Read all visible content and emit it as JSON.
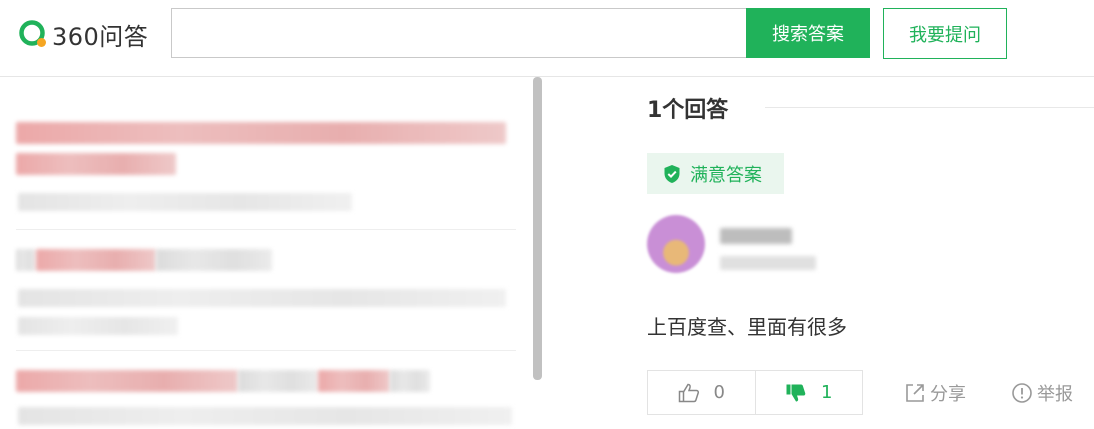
{
  "header": {
    "logo_text": "360问答",
    "search_placeholder": "",
    "search_button": "搜索答案",
    "ask_button": "我要提问"
  },
  "answers": {
    "count_title": "1个回答",
    "badge_label": "满意答案",
    "answer_text": "上百度查、里面有很多",
    "upvotes": "0",
    "downvotes": "1",
    "share_label": "分享",
    "report_label": "举报"
  },
  "colors": {
    "brand_green": "#20b25a",
    "badge_bg": "#eaf6ee",
    "logo_orange": "#f5a623"
  },
  "icons": [
    "logo-icon",
    "shield-check-icon",
    "thumbs-up-icon",
    "thumbs-down-icon",
    "share-icon",
    "report-icon"
  ]
}
